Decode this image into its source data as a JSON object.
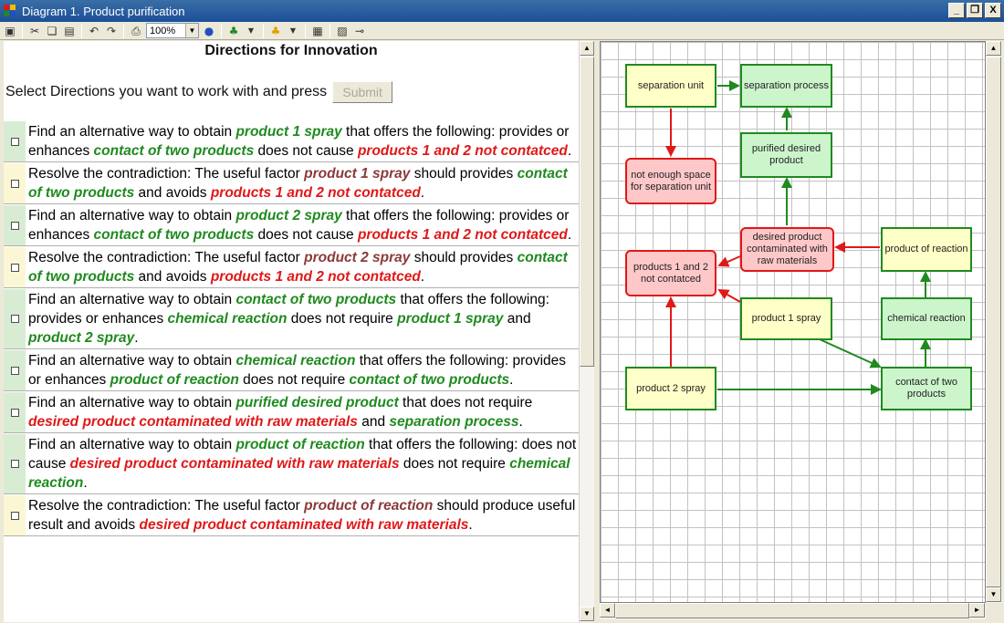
{
  "window": {
    "title": "Diagram 1. Product purification",
    "buttons": [
      "_",
      "❐",
      "X"
    ]
  },
  "toolbar": {
    "zoom": "100%"
  },
  "left": {
    "heading": "Directions for Innovation",
    "prompt": "Select Directions you want to work with and press",
    "submit_label": "Submit"
  },
  "directions": [
    {
      "bg": "green",
      "parts": [
        [
          "n",
          "Find an alternative way to obtain "
        ],
        [
          "g",
          "product 1 spray"
        ],
        [
          "n",
          " that offers the following: provides or enhances "
        ],
        [
          "g",
          "contact of two products"
        ],
        [
          "n",
          " does not cause "
        ],
        [
          "r",
          "products 1 and 2 not contatced"
        ],
        [
          "n",
          "."
        ]
      ]
    },
    {
      "bg": "yellow",
      "parts": [
        [
          "n",
          "Resolve the contradiction: The useful factor "
        ],
        [
          "b",
          "product 1 spray"
        ],
        [
          "n",
          " should provides "
        ],
        [
          "g",
          "contact of two products"
        ],
        [
          "n",
          " and avoids "
        ],
        [
          "r",
          "products 1 and 2 not contatced"
        ],
        [
          "n",
          "."
        ]
      ]
    },
    {
      "bg": "green",
      "parts": [
        [
          "n",
          "Find an alternative way to obtain "
        ],
        [
          "g",
          "product 2 spray"
        ],
        [
          "n",
          " that offers the following: provides or enhances "
        ],
        [
          "g",
          "contact of two products"
        ],
        [
          "n",
          " does not cause "
        ],
        [
          "r",
          "products 1 and 2 not contatced"
        ],
        [
          "n",
          "."
        ]
      ]
    },
    {
      "bg": "yellow",
      "parts": [
        [
          "n",
          "Resolve the contradiction: The useful factor "
        ],
        [
          "b",
          "product 2 spray"
        ],
        [
          "n",
          " should provides "
        ],
        [
          "g",
          "contact of two products"
        ],
        [
          "n",
          " and avoids "
        ],
        [
          "r",
          "products 1 and 2 not contatced"
        ],
        [
          "n",
          "."
        ]
      ]
    },
    {
      "bg": "green",
      "parts": [
        [
          "n",
          "Find an alternative way to obtain "
        ],
        [
          "g",
          "contact of two products"
        ],
        [
          "n",
          " that offers the following: provides or enhances "
        ],
        [
          "g",
          "chemical reaction"
        ],
        [
          "n",
          " does not require "
        ],
        [
          "g",
          "product 1 spray"
        ],
        [
          "n",
          " and "
        ],
        [
          "g",
          "product 2 spray"
        ],
        [
          "n",
          "."
        ]
      ]
    },
    {
      "bg": "green",
      "parts": [
        [
          "n",
          "Find an alternative way to obtain "
        ],
        [
          "g",
          "chemical reaction"
        ],
        [
          "n",
          " that offers the following: provides or enhances "
        ],
        [
          "g",
          "product of reaction"
        ],
        [
          "n",
          " does not require "
        ],
        [
          "g",
          "contact of two products"
        ],
        [
          "n",
          "."
        ]
      ]
    },
    {
      "bg": "green",
      "parts": [
        [
          "n",
          "Find an alternative way to obtain "
        ],
        [
          "g",
          "purified desired product"
        ],
        [
          "n",
          " that does not require "
        ],
        [
          "r",
          "desired product contaminated with raw materials"
        ],
        [
          "n",
          " and "
        ],
        [
          "g",
          "separation process"
        ],
        [
          "n",
          "."
        ]
      ]
    },
    {
      "bg": "green",
      "parts": [
        [
          "n",
          "Find an alternative way to obtain "
        ],
        [
          "g",
          "product of reaction"
        ],
        [
          "n",
          " that offers the following: does not cause "
        ],
        [
          "r",
          "desired product contaminated with raw materials"
        ],
        [
          "n",
          " does not require "
        ],
        [
          "g",
          "chemical reaction"
        ],
        [
          "n",
          "."
        ]
      ]
    },
    {
      "bg": "yellow",
      "parts": [
        [
          "n",
          "Resolve the contradiction: The useful factor "
        ],
        [
          "b",
          "product of reaction"
        ],
        [
          "n",
          " should produce useful result and avoids "
        ],
        [
          "r",
          "desired product contaminated with raw materials"
        ],
        [
          "n",
          "."
        ]
      ]
    }
  ],
  "diagram": {
    "nodes": [
      {
        "id": "sep_unit",
        "label": "separation unit",
        "style": "yellow"
      },
      {
        "id": "sep_proc",
        "label": "separation process",
        "style": "green"
      },
      {
        "id": "purified",
        "label": "purified desired product",
        "style": "green"
      },
      {
        "id": "not_enough",
        "label": "not enough space for separation unit",
        "style": "red"
      },
      {
        "id": "contaminated",
        "label": "desired product contaminated with raw materials",
        "style": "red"
      },
      {
        "id": "prod_reaction",
        "label": "product of reaction",
        "style": "yellow"
      },
      {
        "id": "not_contacted",
        "label": "products 1 and 2 not contatced",
        "style": "red"
      },
      {
        "id": "p1_spray",
        "label": "product 1 spray",
        "style": "yellow"
      },
      {
        "id": "chem_reaction",
        "label": "chemical reaction",
        "style": "green"
      },
      {
        "id": "p2_spray",
        "label": "product 2 spray",
        "style": "yellow"
      },
      {
        "id": "contact",
        "label": "contact of two products",
        "style": "green"
      }
    ]
  }
}
